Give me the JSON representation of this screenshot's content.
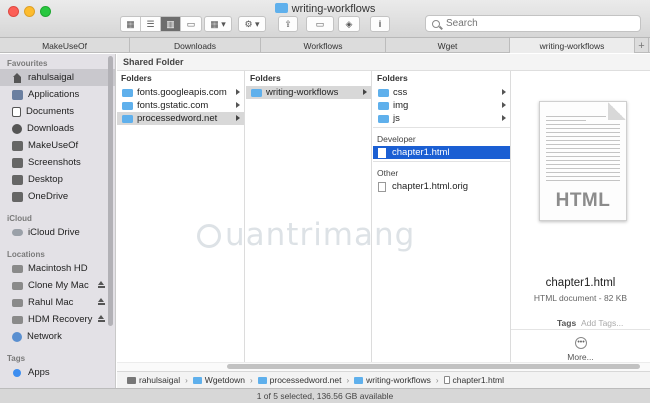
{
  "window": {
    "title": "writing-workflows"
  },
  "search": {
    "placeholder": "Search"
  },
  "toolbar": {
    "view_modes": [
      "icon-view",
      "list-view",
      "column-view",
      "gallery-view"
    ],
    "group_icon": "group-grid-icon",
    "action_icon": "gear-icon",
    "share_icon": "share-icon",
    "tag_icon": "tag-icon",
    "info_label": "i"
  },
  "tabs": [
    {
      "label": "MakeUseOf"
    },
    {
      "label": "Downloads"
    },
    {
      "label": "Workflows"
    },
    {
      "label": "Wget"
    },
    {
      "label": "writing-workflows",
      "active": true
    }
  ],
  "sidebar": {
    "sections": [
      {
        "title": "Favourites",
        "items": [
          {
            "label": "rahulsaigal",
            "icon": "home-icon",
            "selected": true
          },
          {
            "label": "Applications",
            "icon": "applications-icon"
          },
          {
            "label": "Documents",
            "icon": "documents-icon"
          },
          {
            "label": "Downloads",
            "icon": "downloads-icon"
          },
          {
            "label": "MakeUseOf",
            "icon": "folder-icon"
          },
          {
            "label": "Screenshots",
            "icon": "folder-icon"
          },
          {
            "label": "Desktop",
            "icon": "desktop-icon"
          },
          {
            "label": "OneDrive",
            "icon": "folder-icon"
          }
        ]
      },
      {
        "title": "iCloud",
        "items": [
          {
            "label": "iCloud Drive",
            "icon": "cloud-icon"
          }
        ]
      },
      {
        "title": "Locations",
        "items": [
          {
            "label": "Macintosh HD",
            "icon": "disk-icon"
          },
          {
            "label": "Clone My Mac",
            "icon": "disk-icon",
            "eject": true
          },
          {
            "label": "Rahul Mac",
            "icon": "disk-icon",
            "eject": true
          },
          {
            "label": "HDM Recovery",
            "icon": "disk-icon",
            "eject": true
          },
          {
            "label": "Network",
            "icon": "globe-icon"
          }
        ]
      },
      {
        "title": "Tags",
        "items": [
          {
            "label": "Apps",
            "icon": "tag-blue-icon"
          }
        ]
      }
    ]
  },
  "main": {
    "shared_header": "Shared Folder",
    "columns": [
      {
        "header": "Folders",
        "rows": [
          {
            "label": "fonts.googleapis.com",
            "has_children": true
          },
          {
            "label": "fonts.gstatic.com",
            "has_children": true
          },
          {
            "label": "processedword.net",
            "has_children": true,
            "selected": "grey"
          }
        ]
      },
      {
        "header": "Folders",
        "rows": [
          {
            "label": "writing-workflows",
            "has_children": true,
            "selected": "grey"
          }
        ]
      },
      {
        "header": "Folders",
        "rows": [
          {
            "label": "css",
            "has_children": true
          },
          {
            "label": "img",
            "has_children": true
          },
          {
            "label": "js",
            "has_children": true
          }
        ],
        "groups": [
          {
            "header": "Developer",
            "rows": [
              {
                "label": "chapter1.html",
                "selected": "blue"
              }
            ]
          },
          {
            "header": "Other",
            "rows": [
              {
                "label": "chapter1.html.orig"
              }
            ]
          }
        ]
      }
    ],
    "preview": {
      "thumbnail_label": "HTML",
      "name": "chapter1.html",
      "meta": "HTML document - 82 KB",
      "tags_label": "Tags",
      "tags_placeholder": "Add Tags...",
      "more_label": "More..."
    }
  },
  "pathbar": [
    {
      "label": "rahulsaigal",
      "icon": "home-icon"
    },
    {
      "label": "Wgetdown",
      "icon": "folder-icon"
    },
    {
      "label": "processedword.net",
      "icon": "folder-icon"
    },
    {
      "label": "writing-workflows",
      "icon": "folder-icon"
    },
    {
      "label": "chapter1.html",
      "icon": "document-icon"
    }
  ],
  "status": {
    "text": "1 of 5 selected, 136.56 GB available"
  },
  "watermark": {
    "text": "uantrimang"
  },
  "colors": {
    "selection_blue": "#1b5fd3",
    "folder_blue": "#5fb0ec",
    "sidebar_bg": "#e3e1e6"
  }
}
